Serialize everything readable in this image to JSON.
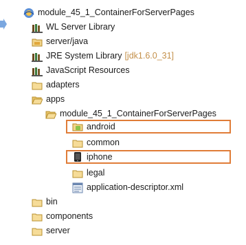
{
  "tree": {
    "project": {
      "label": "module_45_1_ContainerForServerPages",
      "icon": "worklight-project-icon"
    },
    "items": [
      {
        "label": "WL Server Library",
        "icon": "library-icon"
      },
      {
        "label": "server/java",
        "icon": "source-folder-icon"
      },
      {
        "label": "JRE System Library",
        "decoration": "[jdk1.6.0_31]",
        "icon": "library-icon"
      },
      {
        "label": "JavaScript Resources",
        "icon": "library-icon"
      },
      {
        "label": "adapters",
        "icon": "folder-icon"
      },
      {
        "label": "apps",
        "icon": "folder-open-icon"
      },
      {
        "label": "module_45_1_ContainerForServerPages",
        "icon": "folder-open-icon"
      },
      {
        "label": "android",
        "icon": "android-env-icon",
        "highlighted": true
      },
      {
        "label": "common",
        "icon": "folder-icon"
      },
      {
        "label": "iphone",
        "icon": "iphone-env-icon",
        "highlighted": true
      },
      {
        "label": "legal",
        "icon": "folder-icon"
      },
      {
        "label": "application-descriptor.xml",
        "icon": "xml-file-icon"
      },
      {
        "label": "bin",
        "icon": "folder-icon"
      },
      {
        "label": "components",
        "icon": "folder-icon"
      },
      {
        "label": "server",
        "icon": "folder-icon"
      }
    ]
  },
  "colors": {
    "highlight": "#e07c37",
    "pointer_arrow": "#7aa7e0"
  }
}
